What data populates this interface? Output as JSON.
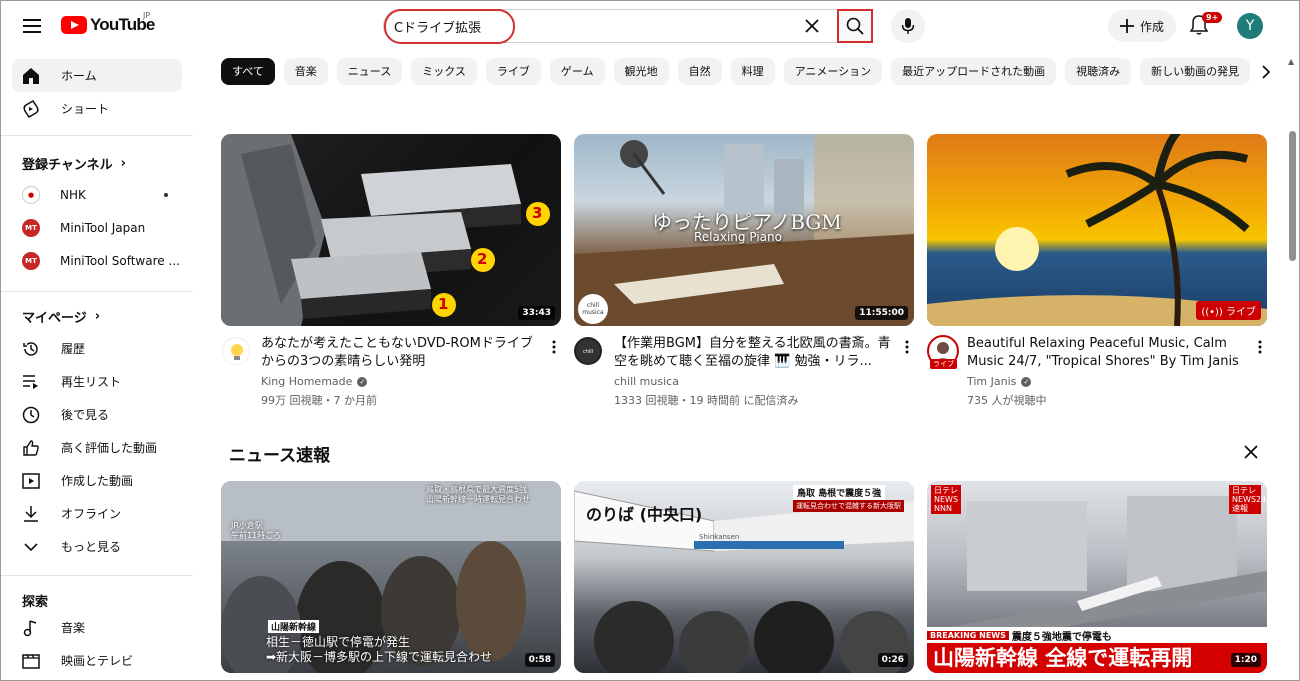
{
  "header": {
    "logo_text": "YouTube",
    "logo_country": "JP",
    "search_value": "Cドライブ拡張",
    "create_label": "作成",
    "notification_badge": "9+",
    "avatar_letter": "Y"
  },
  "sidebar": {
    "main": [
      {
        "label": "ホーム",
        "icon": "home-icon"
      },
      {
        "label": "ショート",
        "icon": "shorts-icon"
      }
    ],
    "subscriptions_heading": "登録チャンネル",
    "subscriptions": [
      {
        "label": "NHK",
        "has_dot": true
      },
      {
        "label": "MiniTool Japan"
      },
      {
        "label": "MiniTool Software ..."
      }
    ],
    "mypage_heading": "マイページ",
    "mypage": [
      {
        "label": "履歴",
        "icon": "history-icon"
      },
      {
        "label": "再生リスト",
        "icon": "playlist-icon"
      },
      {
        "label": "後で見る",
        "icon": "watch-later-icon"
      },
      {
        "label": "高く評価した動画",
        "icon": "thumbs-up-icon"
      },
      {
        "label": "作成した動画",
        "icon": "your-videos-icon"
      },
      {
        "label": "オフライン",
        "icon": "download-icon"
      },
      {
        "label": "もっと見る",
        "icon": "chevron-down-icon"
      }
    ],
    "explore_heading": "探索",
    "explore": [
      {
        "label": "音楽",
        "icon": "music-icon"
      },
      {
        "label": "映画とテレビ",
        "icon": "movies-icon"
      }
    ]
  },
  "chips": [
    "すべて",
    "音楽",
    "ニュース",
    "ミックス",
    "ライブ",
    "ゲーム",
    "観光地",
    "自然",
    "料理",
    "アニメーション",
    "最近アップロードされた動画",
    "視聴済み",
    "新しい動画の発見"
  ],
  "videos": [
    {
      "title": "あなたが考えたこともないDVD-ROMドライブからの3つの素晴らしい発明",
      "channel": "King Homemade",
      "verified": true,
      "meta": "99万 回視聴・7 か月前",
      "duration": "33:43",
      "thumb_numbers": [
        "1",
        "2",
        "3"
      ]
    },
    {
      "title": "【作業用BGM】自分を整える北欧風の書斎。青空を眺めて聴く至福の旋律 🎹 勉強・リラ...",
      "channel": "chill musica",
      "verified": false,
      "meta": "1333 回視聴・19 時間前 に配信済み",
      "duration": "11:55:00",
      "thumb_title": "ゆったりピアノBGM",
      "thumb_subtitle": "Relaxing Piano",
      "thumb_logo": "chill musica"
    },
    {
      "title": "Beautiful Relaxing Peaceful Music, Calm Music 24/7, \"Tropical Shores\" By Tim Janis",
      "channel": "Tim Janis",
      "verified": true,
      "meta": "735 人が視聴中",
      "live_label": "ライブ",
      "avatar_live_label": "ライブ"
    }
  ],
  "news_shelf": {
    "title": "ニュース速報",
    "items": [
      {
        "duration": "0:58",
        "top_caption": "鳥取・島根県で最大震度5強\n山陽新幹線一時運転見合わせ",
        "location": "JR小倉駅\n午前11時ごろ",
        "tag": "山陽新幹線",
        "caption1": "相生－徳山駅で停電が発生",
        "caption2": "➡新大阪－博多駅の上下線で運転見合わせ"
      },
      {
        "duration": "0:26",
        "top_caption": "鳥取 島根で震度５強",
        "top_sub": "運転見合わせで混雑する新大阪駅",
        "sign_text": "のりば (中央口)",
        "sign_sub": "Shinkansen"
      },
      {
        "duration": "1:20",
        "logo": "日テレ NEWS NNN",
        "logo_right": "日テレ NEWS24 速報",
        "breaking": "BREAKING NEWS",
        "breaking_text": "震度５強地震で停電も",
        "headline": "山陽新幹線 全線で運転再開"
      }
    ]
  }
}
